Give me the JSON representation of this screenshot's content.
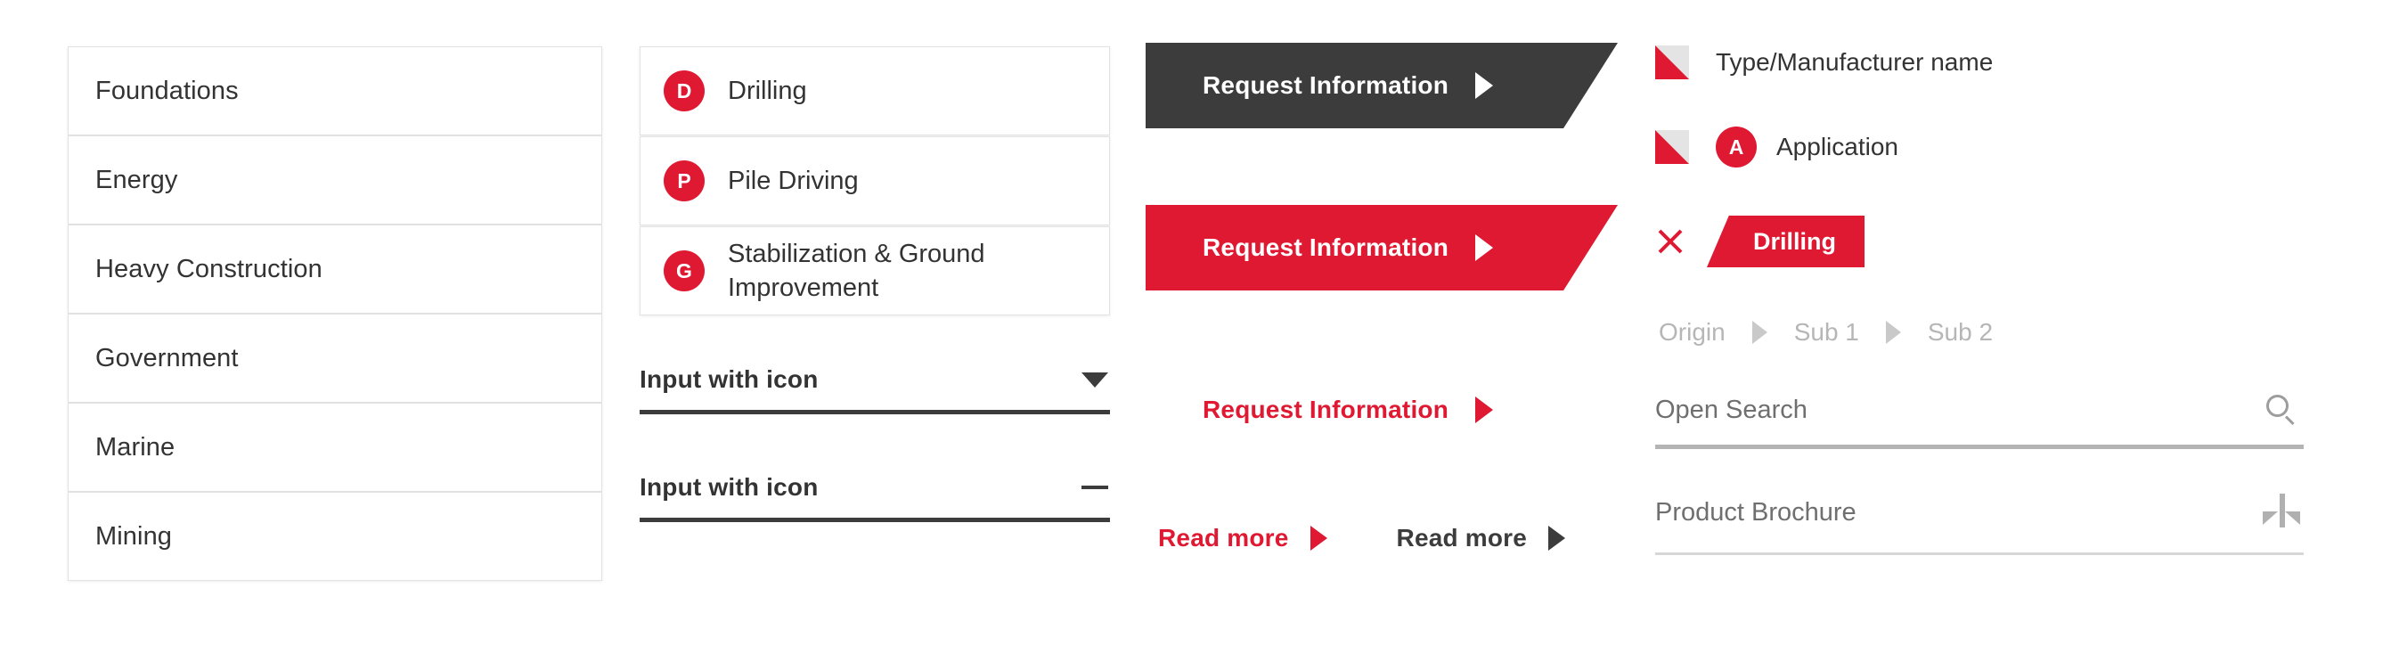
{
  "colors": {
    "brand_red": "#e01933",
    "dark": "#3c3c3c",
    "text": "#333333",
    "muted": "#b6b6b6",
    "border": "#e2e2e2"
  },
  "industries": {
    "items": [
      {
        "label": "Foundations"
      },
      {
        "label": "Energy"
      },
      {
        "label": "Heavy Construction"
      },
      {
        "label": "Government"
      },
      {
        "label": "Marine"
      },
      {
        "label": "Mining"
      }
    ]
  },
  "services": {
    "items": [
      {
        "badge": "D",
        "label": "Drilling"
      },
      {
        "badge": "P",
        "label": "Pile Driving"
      },
      {
        "badge": "G",
        "label": "Stabilization & Ground Improvement"
      }
    ]
  },
  "inputs": {
    "dropdown": {
      "label": "Input with icon",
      "icon": "chevron-down-icon"
    },
    "dash": {
      "label": "Input with icon",
      "icon": "minus-icon"
    }
  },
  "buttons": {
    "dark": {
      "label": "Request Information",
      "icon": "arrow-right-icon"
    },
    "red": {
      "label": "Request Information",
      "icon": "arrow-right-icon"
    },
    "white": {
      "label": "Request Information",
      "icon": "arrow-right-icon"
    }
  },
  "read_more": {
    "primary": {
      "label": "Read more",
      "icon": "arrow-right-icon"
    },
    "secondary": {
      "label": "Read more",
      "icon": "arrow-right-icon"
    }
  },
  "filters": {
    "checkboxes": [
      {
        "label": "Type/Manufacturer name",
        "badge": null
      },
      {
        "label": "Application",
        "badge": "A"
      }
    ],
    "chip": {
      "label": "Drilling",
      "close_icon": "close-icon"
    }
  },
  "breadcrumb": {
    "items": [
      {
        "label": "Origin"
      },
      {
        "label": "Sub 1"
      },
      {
        "label": "Sub 2"
      }
    ]
  },
  "search": {
    "placeholder": "Open Search",
    "icon": "search-icon"
  },
  "brochure": {
    "label": "Product Brochure",
    "icon": "download-icon"
  }
}
